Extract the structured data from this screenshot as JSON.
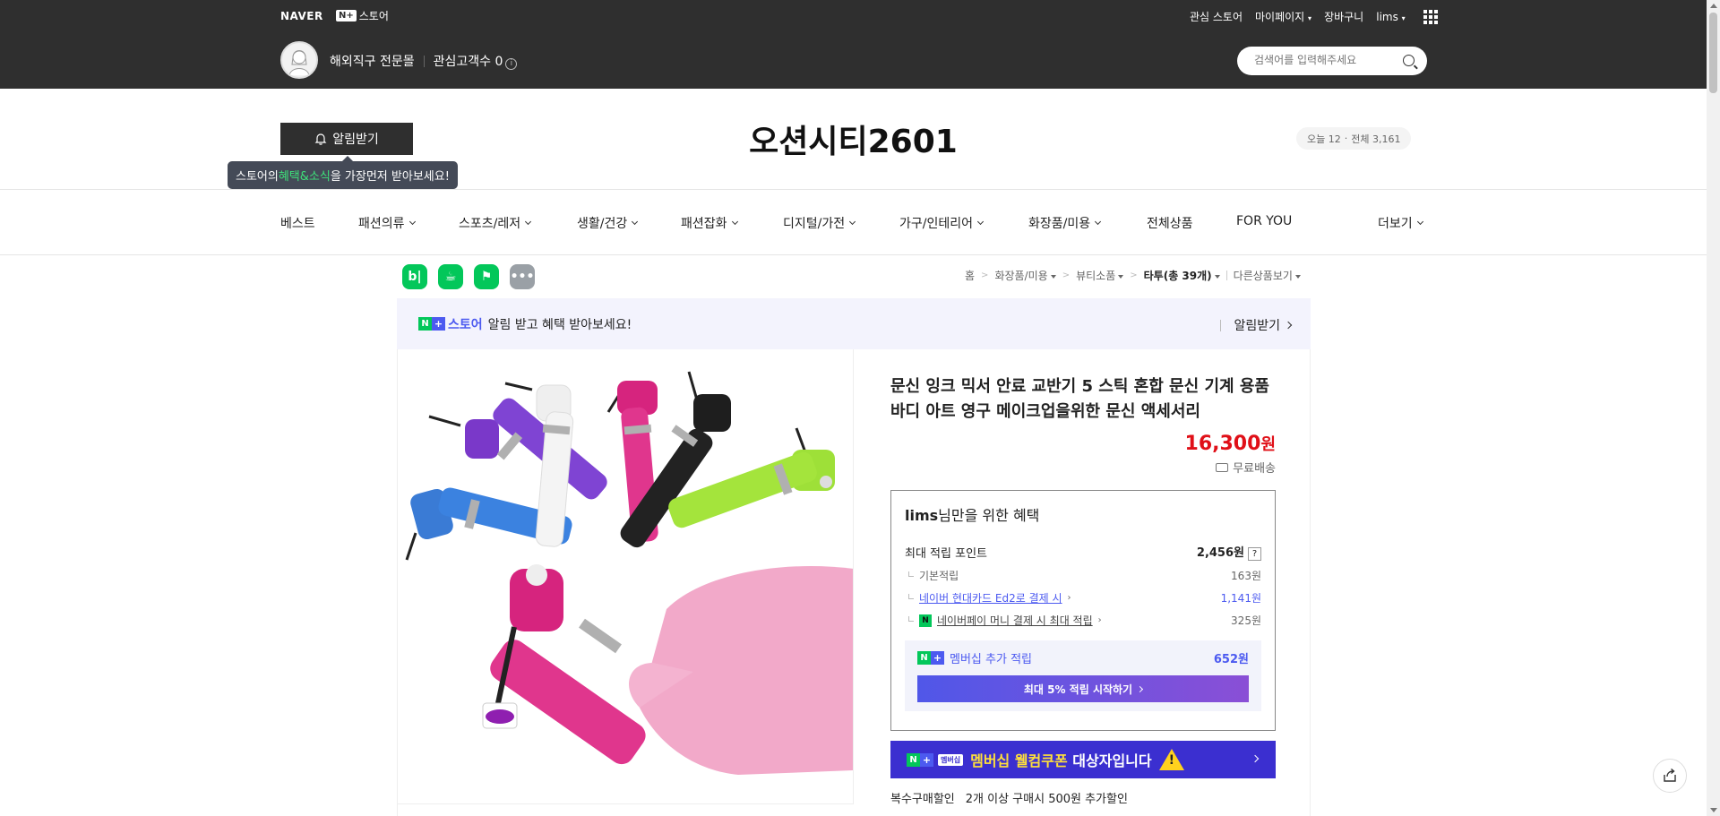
{
  "gnb": {
    "naver": "NAVER",
    "nplus_box": "N+",
    "nplus_store": "스토어",
    "util": [
      "관심 스토어",
      "마이페이지",
      "장바구니",
      "lims"
    ],
    "store_name": "해외직구 전문몰",
    "interest_label": "관심고객수 0",
    "search_placeholder": "검색어를 입력해주세요"
  },
  "store": {
    "alarm_button": "알림받기",
    "tooltip_pre": "스토어의 ",
    "tooltip_hl": "혜택&소식",
    "tooltip_post": "을 가장먼저 받아보세요!",
    "title": "오션시티2601",
    "visitors_today": "오늘 12",
    "visitors_total": "전체 3,161"
  },
  "nav": {
    "items": [
      "베스트",
      "패션의류",
      "스포츠/레저",
      "생활/건강",
      "패션잡화",
      "디지털/가전",
      "가구/인테리어",
      "화장품/미용",
      "전체상품",
      "FOR YOU",
      "더보기"
    ]
  },
  "share": {
    "blog": "b|",
    "cafe": "☕",
    "bookmark": "⚑",
    "more": "•••"
  },
  "breadcrumb": {
    "home": "홈",
    "cat1": "화장품/미용",
    "cat2": "뷰티소품",
    "cat3": "타투(총 39개)",
    "other": "다른상품보기"
  },
  "mbanner": {
    "store": "스토어",
    "msg": "알림 받고 혜택 받아보세요!",
    "right": "알림받기"
  },
  "product": {
    "title": "문신 잉크 믹서 안료 교반기 5 스틱 혼합 문신 기계 용품 바디 아트 영구 메이크업을위한 문신 액세서리",
    "price": "16,300",
    "won": "원",
    "shipping": "무료배송"
  },
  "benefit": {
    "title_user": "lims",
    "title_rest": "님만을 위한 혜택",
    "max_point_label": "최대 적립 포인트",
    "max_point_value": "2,456원",
    "basic_label": "기본적립",
    "basic_value": "163원",
    "card_label": "네이버 현대카드 Ed2로 결제 시",
    "card_value": "1,141원",
    "npay_label": "네이버페이 머니 결제 시 최대 적립",
    "npay_value": "325원",
    "membership_label": "멤버십 추가 적립",
    "membership_value": "652원",
    "cta": "최대 5% 적립 시작하기"
  },
  "welcome": {
    "pill": "멤버십",
    "text_hl": "멤버십 웰컴쿠폰",
    "text_rest": " 대상자입니다"
  },
  "multi": {
    "label": "복수구매할인",
    "value": "2개 이상 구매시 500원 추가할인"
  },
  "colors": {
    "header_bg": "#2f2f2f",
    "naver_green": "#03c75a",
    "accent_purple": "#4c5af0",
    "price_red": "#e01018",
    "welcome_bg": "#3b2fd0"
  }
}
